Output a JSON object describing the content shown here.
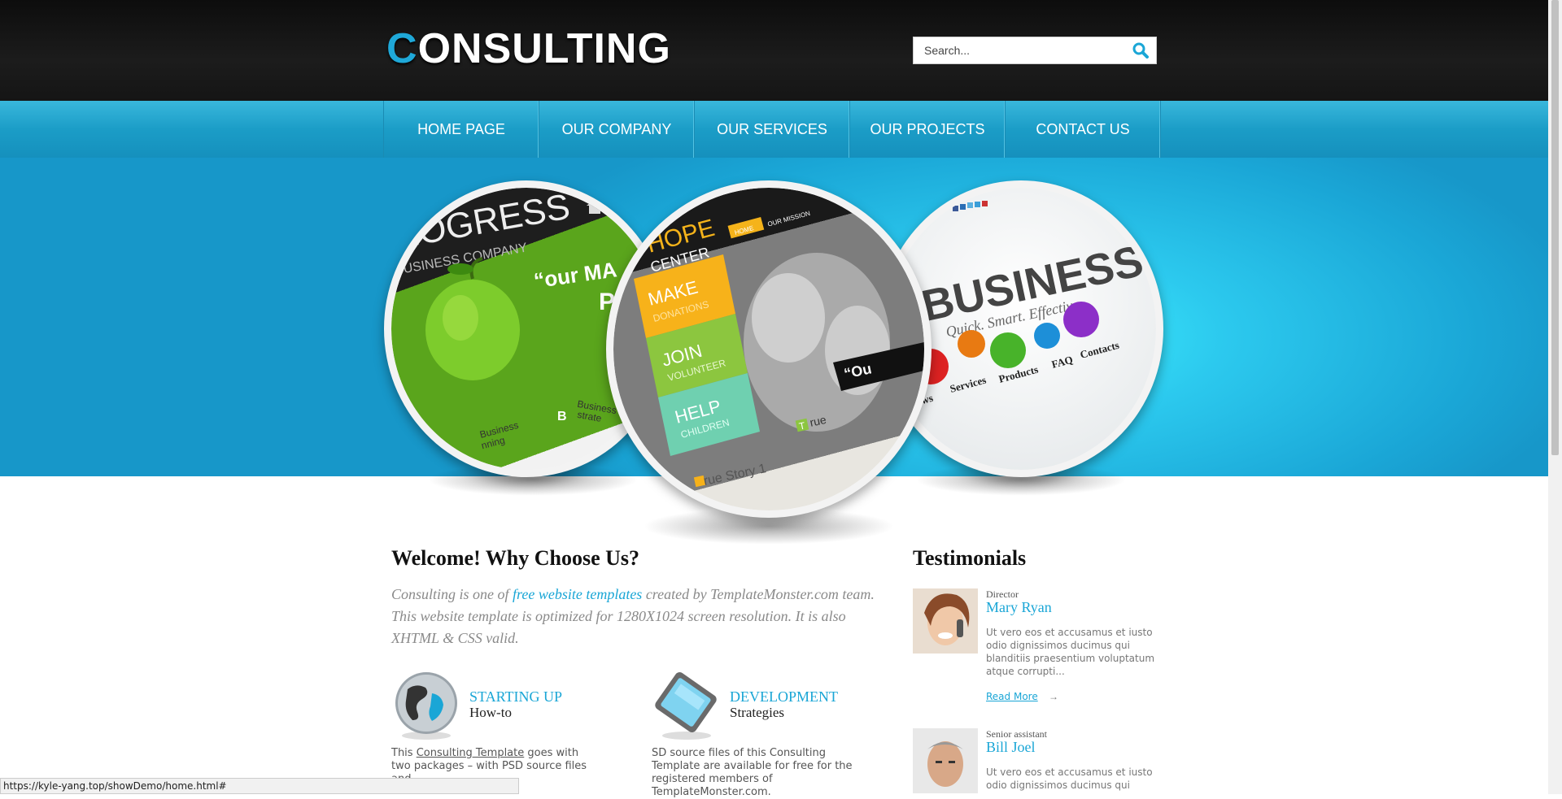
{
  "header": {
    "logo_first": "C",
    "logo_rest": "ONSULTING",
    "search_placeholder": "Search..."
  },
  "nav": {
    "items": [
      {
        "label": "HOME PAGE"
      },
      {
        "label": "OUR COMPANY"
      },
      {
        "label": "OUR SERVICES"
      },
      {
        "label": "OUR PROJECTS"
      },
      {
        "label": "CONTACT US"
      }
    ]
  },
  "slider": {
    "slide1": {
      "heading": "ROGRESS",
      "sub": "BUSINESS COMPANY",
      "quote": "“our MA",
      "quote2": "P",
      "badge": "B",
      "badge_text1": "Business",
      "badge_text2": "strate",
      "bottom1": "Business",
      "bottom2": "nning"
    },
    "slide2": {
      "title1": "HOPE",
      "title2": "CENTER",
      "nav_home": "HOME",
      "nav_mission": "OUR MISSION",
      "make": "MAKE",
      "make_sub": "DONATIONS",
      "join": "JOIN",
      "join_sub": "VOLUNTEER",
      "help": "HELP",
      "help_sub": "CHILDREN",
      "story": "rue Story 1",
      "quote": "“Ou",
      "t": "T",
      "rue": "rue"
    },
    "slide3": {
      "title": "BUSINESS",
      "tagline": "Quick. Smart. Effective",
      "labels": [
        "News",
        "Services",
        "Products",
        "FAQ",
        "Contacts"
      ]
    }
  },
  "welcome": {
    "title": "Welcome! Why Choose Us?",
    "intro_before": "Consulting is one of ",
    "intro_link": "free website templates",
    "intro_after": " created by TemplateMonster.com team. This website template is optimized for 1280X1024 screen resolution. It is also XHTML & CSS valid."
  },
  "features": [
    {
      "title": "STARTING UP",
      "subtitle": "How-to",
      "desc_before": "This ",
      "desc_link": "Consulting Template",
      "desc_after": " goes with two packages – with PSD source files and",
      "icon": "globe-icon"
    },
    {
      "title": "DEVELOPMENT",
      "subtitle": "Strategies",
      "desc": "SD source files of this Consulting Template are available for free for the registered members of TemplateMonster.com.",
      "icon": "tablet-icon"
    }
  ],
  "testimonials": {
    "title": "Testimonials",
    "items": [
      {
        "role": "Director",
        "name": "Mary Ryan",
        "quote": "Ut vero eos et accusamus et iusto odio dignissimos ducimus qui blanditiis praesentium voluptatum atque corrupti...",
        "more": "Read More",
        "arrow": "→"
      },
      {
        "role": "Senior assistant",
        "name": "Bill Joel",
        "quote": "Ut vero eos et accusamus et iusto odio dignissimos ducimus qui"
      }
    ]
  },
  "status_url": "https://kyle-yang.top/showDemo/home.html#",
  "colors": {
    "accent": "#1aa6d6",
    "header_bg": "#121212",
    "nav_bg": "#1b9dc7"
  }
}
